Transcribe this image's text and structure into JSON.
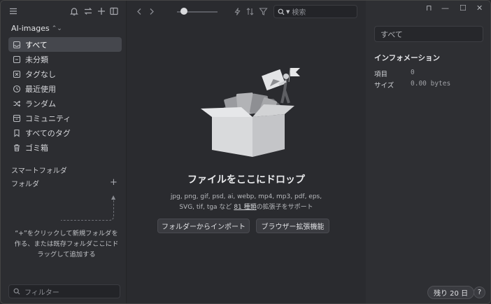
{
  "sidebar": {
    "library_name": "AI-images",
    "nav": [
      {
        "label": "すべて",
        "icon": "inbox-icon",
        "active": true
      },
      {
        "label": "未分類",
        "icon": "unsorted-icon"
      },
      {
        "label": "タグなし",
        "icon": "untagged-icon"
      },
      {
        "label": "最近使用",
        "icon": "clock-icon"
      },
      {
        "label": "ランダム",
        "icon": "shuffle-icon"
      },
      {
        "label": "コミュニティ",
        "icon": "community-icon"
      },
      {
        "label": "すべてのタグ",
        "icon": "bookmark-icon"
      },
      {
        "label": "ゴミ箱",
        "icon": "trash-icon"
      }
    ],
    "smart_folders": "スマートフォルダ",
    "folders": "フォルダ",
    "hint": "“+”をクリックして新規フォルダを作る、または既存フォルダここにドラッグして追加する",
    "filter_placeholder": "フィルター"
  },
  "toolbar": {
    "search_placeholder": "検索"
  },
  "main": {
    "drop_title": "ファイルをここにドロップ",
    "formats_line1": "jpg, png, gif, psd, ai, webp, mp4, mp3, pdf, eps,",
    "formats_line2_pre": "SVG, tif, tga など",
    "formats_link": "81 種類",
    "formats_line2_post": "の拡張子をサポート",
    "import_button": "フォルダーからインポート",
    "extension_button": "ブラウザー拡張機能"
  },
  "inspector": {
    "name_value": "すべて",
    "info_title": "インフォメーション",
    "rows": [
      {
        "label": "項目",
        "value": "0"
      },
      {
        "label": "サイズ",
        "value": "0.00 bytes"
      }
    ],
    "trial_label": "残り 20 日",
    "help_label": "?"
  },
  "colors": {
    "background": "#2a2b2f",
    "sidebar": "#2c2d31",
    "active_item": "#45474d"
  }
}
